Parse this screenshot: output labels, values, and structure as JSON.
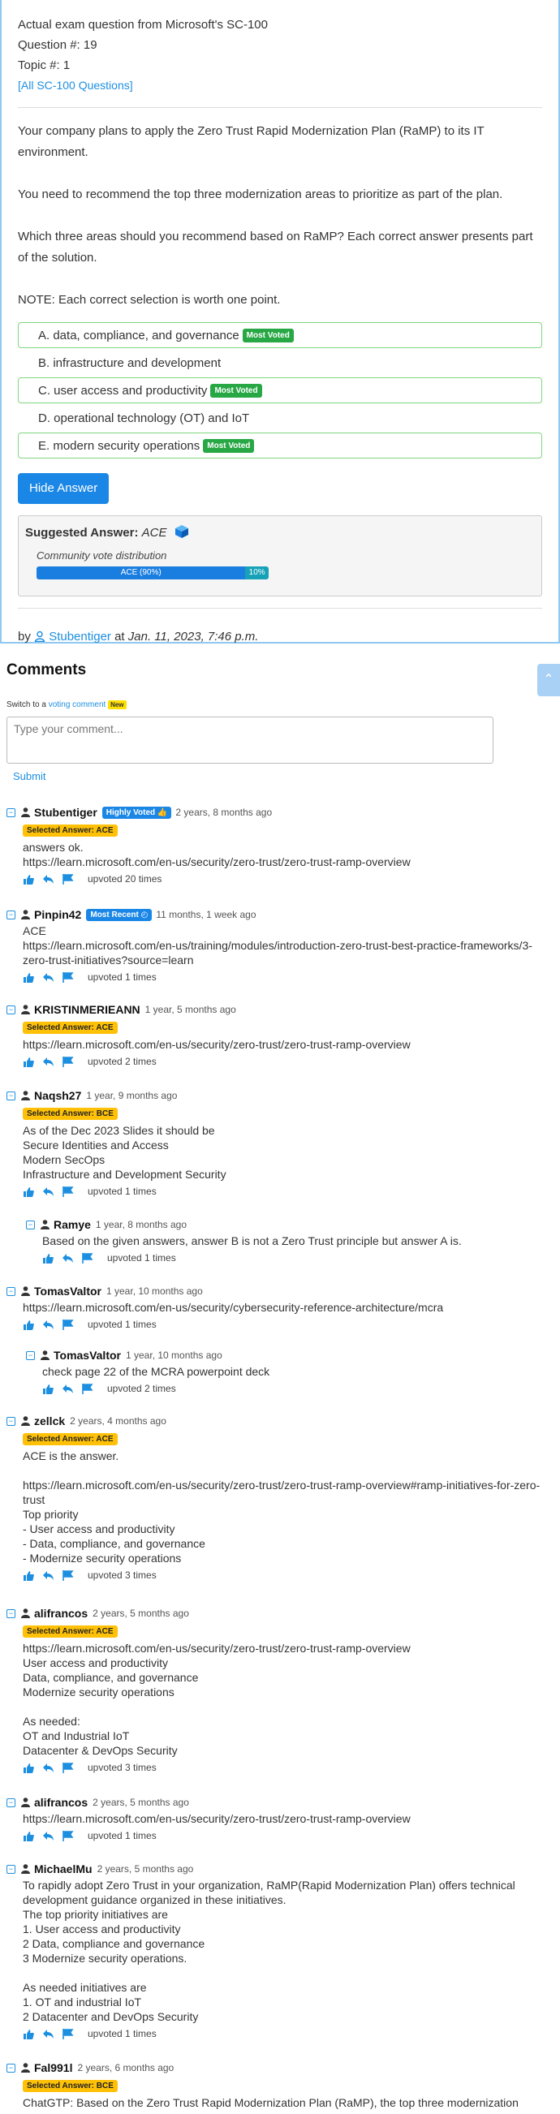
{
  "meta": {
    "line1": "Actual exam question from Microsoft's SC-100",
    "line2": "Question #: 19",
    "line3": "Topic #: 1",
    "link": "[All SC-100 Questions]"
  },
  "question": {
    "p1": "Your company plans to apply the Zero Trust Rapid Modernization Plan (RaMP) to its IT environment.",
    "p2": "You need to recommend the top three modernization areas to prioritize as part of the plan.",
    "p3": "Which three areas should you recommend based on RaMP? Each correct answer presents part of the solution.",
    "p4": "NOTE: Each correct selection is worth one point."
  },
  "choices": [
    {
      "text": "A. data, compliance, and governance",
      "badge": "Most Voted"
    },
    {
      "text": "B. infrastructure and development",
      "badge": ""
    },
    {
      "text": "C. user access and productivity",
      "badge": "Most Voted"
    },
    {
      "text": "D. operational technology (OT) and IoT",
      "badge": ""
    },
    {
      "text": "E. modern security operations",
      "badge": "Most Voted"
    }
  ],
  "hide_button": "Hide Answer",
  "suggested": {
    "label": "Suggested Answer:",
    "value": "ACE",
    "vote_title": "Community vote distribution",
    "bar_a": "ACE (90%)",
    "bar_b": "10%",
    "bar_a_pct": 90,
    "bar_b_pct": 10
  },
  "byline": {
    "by": "by",
    "user": "Stubentiger",
    "at": "at",
    "date": "Jan. 11, 2023, 7:46 p.m."
  },
  "comments_title": "Comments",
  "switch": {
    "text": "Switch to a",
    "link": "voting comment",
    "badge": "New"
  },
  "comment_placeholder": "Type your comment...",
  "submit": "Submit",
  "comments": [
    {
      "user": "Stubentiger",
      "badge": "Highly Voted",
      "time": "2 years, 8 months ago",
      "sel": "Selected Answer: ACE",
      "text": "answers ok.\nhttps://learn.microsoft.com/en-us/security/zero-trust/zero-trust-ramp-overview",
      "upvotes": "upvoted 20 times"
    },
    {
      "user": "Pinpin42",
      "badge": "Most Recent",
      "time": "11 months, 1 week ago",
      "sel": "",
      "text": "ACE\nhttps://learn.microsoft.com/en-us/training/modules/introduction-zero-trust-best-practice-frameworks/3-zero-trust-initiatives?source=learn",
      "upvotes": "upvoted 1 times"
    },
    {
      "user": "KRISTINMERIEANN",
      "badge": "",
      "time": "1 year, 5 months ago",
      "sel": "Selected Answer: ACE",
      "text": "https://learn.microsoft.com/en-us/security/zero-trust/zero-trust-ramp-overview",
      "upvotes": "upvoted 2 times"
    },
    {
      "user": "Naqsh27",
      "badge": "",
      "time": "1 year, 9 months ago",
      "sel": "Selected Answer: BCE",
      "text": "As of the Dec 2023 Slides it should be\nSecure Identities and Access\nModern SecOps\nInfrastructure and Development Security",
      "upvotes": "upvoted 1 times"
    },
    {
      "user": "Ramye",
      "badge": "",
      "time": "1 year, 8 months ago",
      "sel": "",
      "text": "Based on the given answers, answer B is not a Zero Trust principle but answer A is.",
      "upvotes": "upvoted 1 times"
    },
    {
      "user": "TomasValtor",
      "badge": "",
      "time": "1 year, 10 months ago",
      "sel": "",
      "text": "https://learn.microsoft.com/en-us/security/cybersecurity-reference-architecture/mcra",
      "upvotes": "upvoted 1 times"
    },
    {
      "user": "TomasValtor",
      "badge": "",
      "time": "1 year, 10 months ago",
      "sel": "",
      "text": "check page 22 of the MCRA powerpoint deck",
      "upvotes": "upvoted 2 times"
    },
    {
      "user": "zellck",
      "badge": "",
      "time": "2 years, 4 months ago",
      "sel": "Selected Answer: ACE",
      "text": "ACE is the answer.\n\nhttps://learn.microsoft.com/en-us/security/zero-trust/zero-trust-ramp-overview#ramp-initiatives-for-zero-trust\nTop priority\n- User access and productivity\n- Data, compliance, and governance\n- Modernize security operations",
      "upvotes": "upvoted 3 times"
    },
    {
      "user": "alifrancos",
      "badge": "",
      "time": "2 years, 5 months ago",
      "sel": "Selected Answer: ACE",
      "text": "https://learn.microsoft.com/en-us/security/zero-trust/zero-trust-ramp-overview\nUser access and productivity\nData, compliance, and governance\nModernize security operations\n\nAs needed:\nOT and Industrial IoT\nDatacenter & DevOps Security",
      "upvotes": "upvoted 3 times"
    },
    {
      "user": "alifrancos",
      "badge": "",
      "time": "2 years, 5 months ago",
      "sel": "",
      "text": "https://learn.microsoft.com/en-us/security/zero-trust/zero-trust-ramp-overview",
      "upvotes": "upvoted 1 times"
    },
    {
      "user": "MichaelMu",
      "badge": "",
      "time": "2 years, 5 months ago",
      "sel": "",
      "text": "To rapidly adopt Zero Trust in your organization, RaMP(Rapid Modernization Plan) offers technical development guidance organized in these initiatives.\nThe top priority initiatives are\n1. User access and productivity\n2 Data, compliance and governance\n3 Modernize security operations.\n\nAs needed initiatives are\n1. OT and industrial IoT\n2 Datacenter and DevOps Security",
      "upvotes": "upvoted 1 times"
    },
    {
      "user": "Fal991l",
      "badge": "",
      "time": "2 years, 6 months ago",
      "sel": "Selected Answer: BCE",
      "text": "ChatGTP: Based on the Zero Trust Rapid Modernization Plan (RaMP), the top three modernization",
      "upvotes": ""
    }
  ]
}
